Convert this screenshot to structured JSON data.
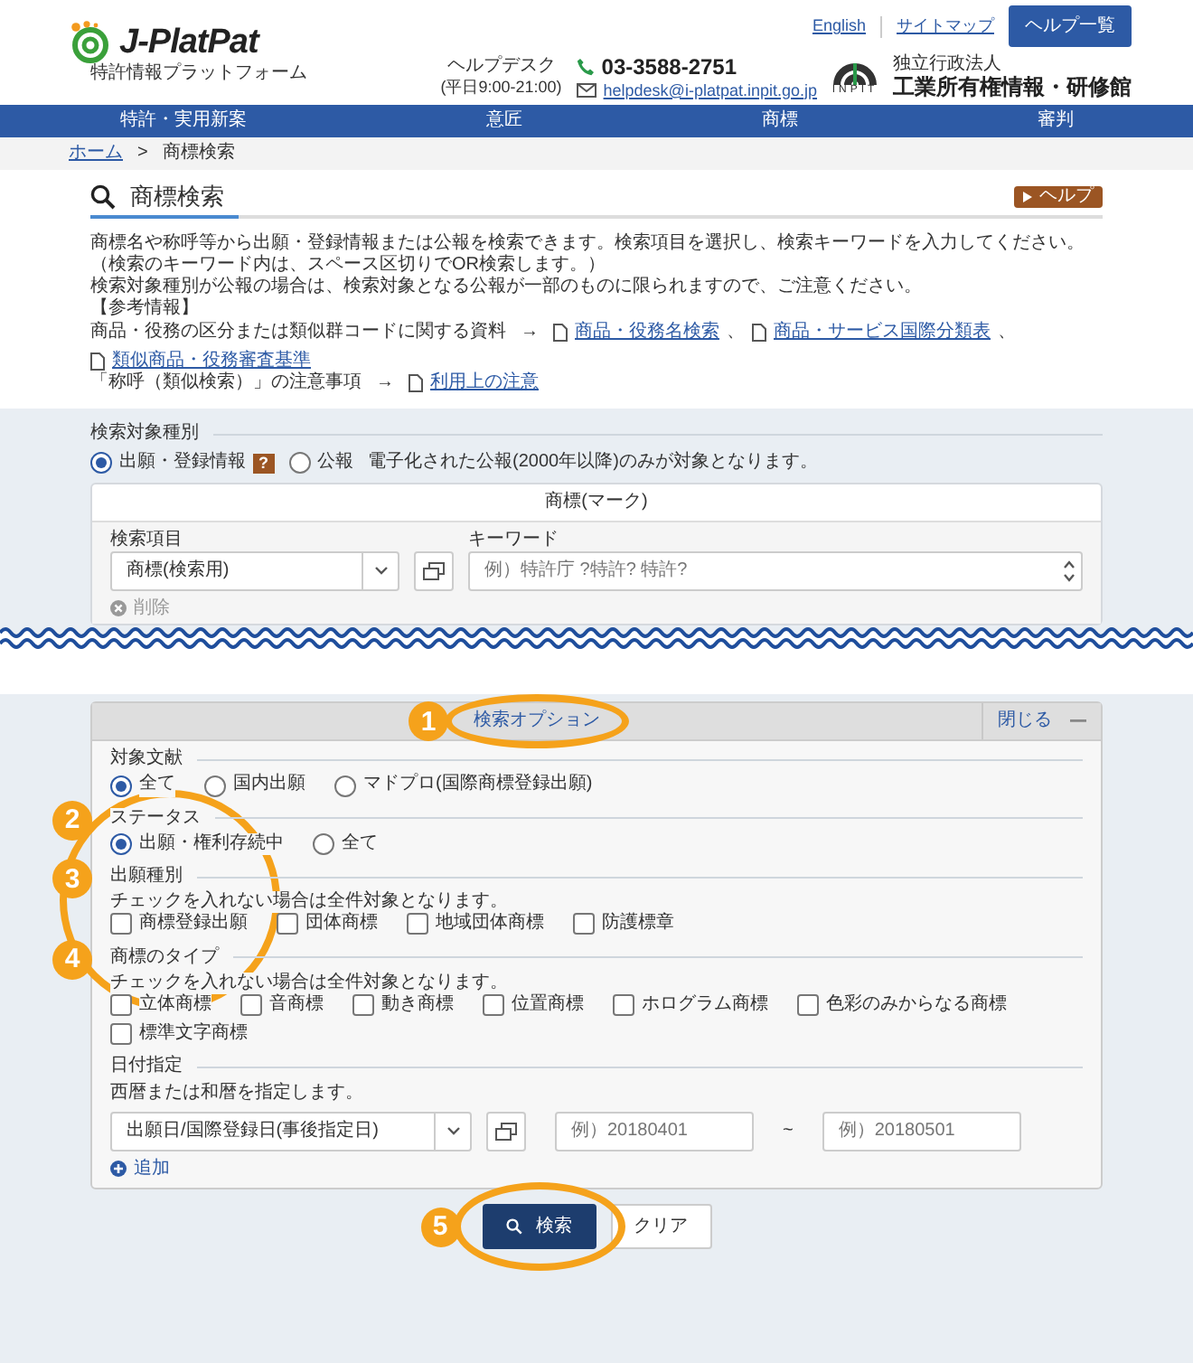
{
  "header": {
    "logo": "J-PlatPat",
    "logo_subtitle": "特許情報プラットフォーム",
    "links": [
      "English",
      "サイトマップ"
    ],
    "help_button": "ヘルプ一覧",
    "helpdesk_label": "ヘルプデスク",
    "helpdesk_hours": "(平日9:00-21:00)",
    "phone": "03-3588-2751",
    "email": "helpdesk@i-platpat.inpit.go.jp",
    "org_logo_text": "INPIT",
    "org_type": "独立行政法人",
    "org_name": "工業所有権情報・研修館"
  },
  "nav": [
    "特許・実用新案",
    "意匠",
    "商標",
    "審判"
  ],
  "breadcrumb": {
    "items": [
      "ホーム",
      "商標検索"
    ],
    "separator": ">"
  },
  "page": {
    "title": "商標検索",
    "help_badge": "ヘルプ",
    "description": [
      "商標名や称呼等から出願・登録情報または公報を検索できます。検索項目を選択し、検索キーワードを入力してください。（検索のキーワード内は、スペース区切りでOR検索します。）",
      "検索対象種別が公報の場合は、検索対象となる公報が一部のものに限られますので、ご注意ください。",
      "【参考情報】"
    ],
    "references": [
      {
        "label": "商品・役務の区分または類似群コードに関する資料",
        "arrow": "→",
        "separator": "、",
        "links": [
          "商品・役務名検索",
          "商品・サービス国際分類表",
          "類似商品・役務審査基準"
        ]
      },
      {
        "label": "「称呼（類似検索）」の注意事項",
        "arrow": "→",
        "links": [
          "利用上の注意"
        ]
      }
    ]
  },
  "search_target": {
    "label": "検索対象種別",
    "help_mark": "?",
    "options": [
      {
        "label": "出願・登録情報",
        "selected": true
      },
      {
        "label": "公報",
        "selected": false
      }
    ],
    "note": "電子化された公報(2000年以降)のみが対象となります。"
  },
  "mark_card": {
    "title": "商標(マーク)",
    "item_label": "検索項目",
    "item_value": "商標(検索用)",
    "keyword_label": "キーワード",
    "keyword_placeholder": "例）特許庁 ?特許? 特許?",
    "delete_label": "削除"
  },
  "options_panel": {
    "title": "検索オプション",
    "annotation": "1",
    "circled": true,
    "close_label": "閉じる",
    "sections": [
      {
        "kind": "radio",
        "label": "対象文献",
        "options": [
          {
            "label": "全て",
            "selected": true
          },
          {
            "label": "国内出願",
            "selected": false
          },
          {
            "label": "マドプロ(国際商標登録出願)",
            "selected": false
          }
        ]
      },
      {
        "kind": "radio",
        "label": "ステータス",
        "annotation": "2",
        "circled": true,
        "options": [
          {
            "label": "出願・権利存続中",
            "selected": true
          },
          {
            "label": "全て",
            "selected": false
          }
        ]
      },
      {
        "kind": "checkbox",
        "label": "出願種別",
        "annotation": "3",
        "note": "チェックを入れない場合は全件対象となります。",
        "options": [
          {
            "label": "商標登録出願",
            "checked": false
          },
          {
            "label": "団体商標",
            "checked": false
          },
          {
            "label": "地域団体商標",
            "checked": false
          },
          {
            "label": "防護標章",
            "checked": false
          }
        ]
      },
      {
        "kind": "checkbox",
        "label": "商標のタイプ",
        "annotation": "4",
        "note": "チェックを入れない場合は全件対象となります。",
        "options": [
          {
            "label": "立体商標",
            "checked": false
          },
          {
            "label": "音商標",
            "checked": false
          },
          {
            "label": "動き商標",
            "checked": false
          },
          {
            "label": "位置商標",
            "checked": false
          },
          {
            "label": "ホログラム商標",
            "checked": false
          },
          {
            "label": "色彩のみからなる商標",
            "checked": false
          },
          {
            "label": "標準文字商標",
            "checked": false
          }
        ]
      },
      {
        "kind": "date",
        "label": "日付指定",
        "note": "西暦または和暦を指定します。",
        "select_value": "出願日/国際登録日(事後指定日)",
        "from_placeholder": "例）20180401",
        "range_separator": "~",
        "to_placeholder": "例）20180501",
        "add_label": "追加"
      }
    ]
  },
  "buttons": {
    "search": "検索",
    "clear": "クリア",
    "annotation": "5",
    "circled": true
  }
}
